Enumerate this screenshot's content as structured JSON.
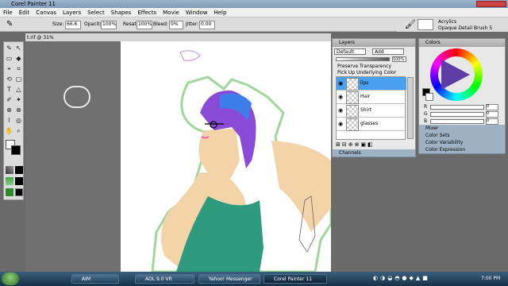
{
  "window": {
    "title": "Corel Painter 11"
  },
  "menu": [
    "File",
    "Edit",
    "Canvas",
    "Layers",
    "Select",
    "Shapes",
    "Effects",
    "Movie",
    "Window",
    "Help"
  ],
  "propbar": {
    "size_label": "Size:",
    "size_value": "66.6",
    "opacity_label": "Opacity:",
    "opacity_value": "100%",
    "resat_label": "Resat:",
    "resat_value": "100%",
    "bleed_label": "Bleed:",
    "bleed_value": "0%",
    "jitter_label": "Jitter:",
    "jitter_value": "0.00"
  },
  "brush": {
    "category": "Acrylics",
    "variant": "Opaque Detail Brush 5"
  },
  "document": {
    "tab_title": "t.rif @ 31%"
  },
  "layers_panel": {
    "title": "Layers",
    "composite_method": "Default",
    "blend_mode": "Add",
    "opacity": "100%",
    "preserve_transparency": "Preserve Transparency",
    "pick_up_color": "Pick Up Underlying Color",
    "layers": [
      {
        "name": "lips",
        "selected": true
      },
      {
        "name": "Hair",
        "selected": false
      },
      {
        "name": "Shirt",
        "selected": false
      },
      {
        "name": "glasses",
        "selected": false
      }
    ],
    "channels_title": "Channels"
  },
  "colors_panel": {
    "title": "Colors",
    "sliders": [
      {
        "label": "R",
        "value": "0"
      },
      {
        "label": "G",
        "value": "0"
      },
      {
        "label": "B",
        "value": "0"
      }
    ],
    "collapsed": [
      "Mixer",
      "Color Sets",
      "Color Variability",
      "Color Expression"
    ]
  },
  "taskbar": {
    "items": [
      "AIM",
      "AOL 9.0 VR",
      "Yahoo! Messenger",
      "Corel Painter 11"
    ],
    "clock": "7:00 PM"
  },
  "colors": {
    "swatch_primary": "#000000",
    "swatch_secondary": "#ffffff",
    "layer_selected": "#4aa0f0"
  }
}
